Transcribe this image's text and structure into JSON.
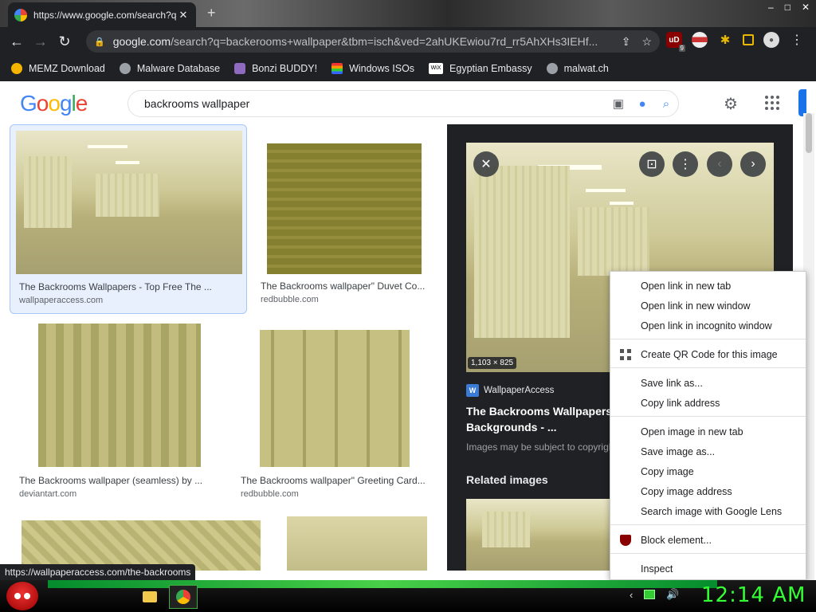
{
  "browser": {
    "tab_title": "https://www.google.com/search?q=",
    "tab_close": "✕",
    "new_tab": "+",
    "window_controls": [
      "–",
      "□",
      "✕"
    ],
    "url_host": "google.com",
    "url_rest": "/search?q=backerooms+wallpaper&tbm=isch&ved=2ahUKEwiou7rd_rr5AhXHs3IEHf...",
    "ext_badge": "9",
    "ublock_label": "uD"
  },
  "bookmarks": [
    {
      "label": "MEMZ Download",
      "color": "#f4b400"
    },
    {
      "label": "Malware Database",
      "color": "#9aa0a6"
    },
    {
      "label": "Bonzi BUDDY!",
      "color": "#8e6bbf"
    },
    {
      "label": "Windows ISOs",
      "color": "#ea4335"
    },
    {
      "label": "Egyptian Embassy",
      "color": "#ffffff"
    },
    {
      "label": "malwat.ch",
      "color": "#9aa0a6"
    }
  ],
  "bookmark_icon_text": {
    "wix": "WiX"
  },
  "google": {
    "logo_letters": [
      "G",
      "o",
      "o",
      "g",
      "l",
      "e"
    ],
    "logo_colors": [
      "#4285f4",
      "#ea4335",
      "#fbbc05",
      "#4285f4",
      "#34a853",
      "#ea4335"
    ],
    "query": "backrooms wallpaper"
  },
  "results": [
    {
      "caption": "The Backrooms Wallpapers - Top Free The ...",
      "source": "wallpaperaccess.com",
      "selected": true
    },
    {
      "caption": "The Backrooms wallpaper\" Duvet Co...",
      "source": "redbubble.com",
      "selected": false
    },
    {
      "caption": "The Backrooms wallpaper (seamless) by ...",
      "source": "deviantart.com",
      "selected": false
    },
    {
      "caption": "The Backrooms wallpaper\" Greeting Card...",
      "source": "redbubble.com",
      "selected": false
    }
  ],
  "preview": {
    "dimensions": "1,103 × 825",
    "source_icon": "W",
    "source_name": "WallpaperAccess",
    "title": "The Backrooms Wallpapers - Top Free The Backrooms Backgrounds - ...",
    "notice": "Images may be subject to copyright.",
    "related_heading": "Related images"
  },
  "context_menu": {
    "groups": [
      [
        "Open link in new tab",
        "Open link in new window",
        "Open link in incognito window"
      ],
      [
        "Create QR Code for this image"
      ],
      [
        "Save link as...",
        "Copy link address"
      ],
      [
        "Open image in new tab",
        "Save image as...",
        "Copy image",
        "Copy image address",
        "Search image with Google Lens"
      ],
      [
        "Block element..."
      ],
      [
        "Inspect"
      ]
    ],
    "block_icon_color": "#800000"
  },
  "status_url": "https://wallpaperaccess.com/the-backrooms",
  "taskbar": {
    "clock": "12:14 AM"
  }
}
